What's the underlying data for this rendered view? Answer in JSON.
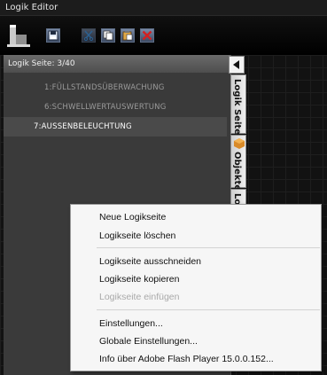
{
  "app": {
    "title": "Logik Editor"
  },
  "toolbar": {
    "icons": [
      "building-logo-icon",
      "save-icon",
      "cut-icon",
      "copy-icon",
      "paste-icon",
      "delete-icon"
    ]
  },
  "panel": {
    "header": "Logik Seite: 3/40",
    "pages": [
      {
        "label": "1:FÜLLSTANDSÜBERWACHUNG",
        "active": false
      },
      {
        "label": "6:SCHWELLWERTAUSWERTUNG",
        "active": false
      },
      {
        "label": "7:AUSSENBELEUCHTUNG",
        "active": true
      }
    ]
  },
  "side_tabs": [
    {
      "label": "Logik Seite"
    },
    {
      "label": "Objekte",
      "icon": "cube-icon"
    },
    {
      "label": "Lo"
    }
  ],
  "context_menu": {
    "items": [
      {
        "label": "Neue Logikseite",
        "enabled": true
      },
      {
        "label": "Logikseite löschen",
        "enabled": true
      },
      {
        "label": "Logikseite ausschneiden",
        "enabled": true
      },
      {
        "label": "Logikseite kopieren",
        "enabled": true
      },
      {
        "label": "Logikseite einfügen",
        "enabled": false
      },
      {
        "label": "Einstellungen...",
        "enabled": true
      },
      {
        "label": "Globale Einstellungen...",
        "enabled": true
      },
      {
        "label": "Info über Adobe Flash Player 15.0.0.152...",
        "enabled": true
      }
    ]
  },
  "colors": {
    "background": "#141414",
    "panel": "#3a3a3a",
    "active_item": "#4a4a4a",
    "menu": "#f6f6f6",
    "delete_red": "#d32020"
  }
}
